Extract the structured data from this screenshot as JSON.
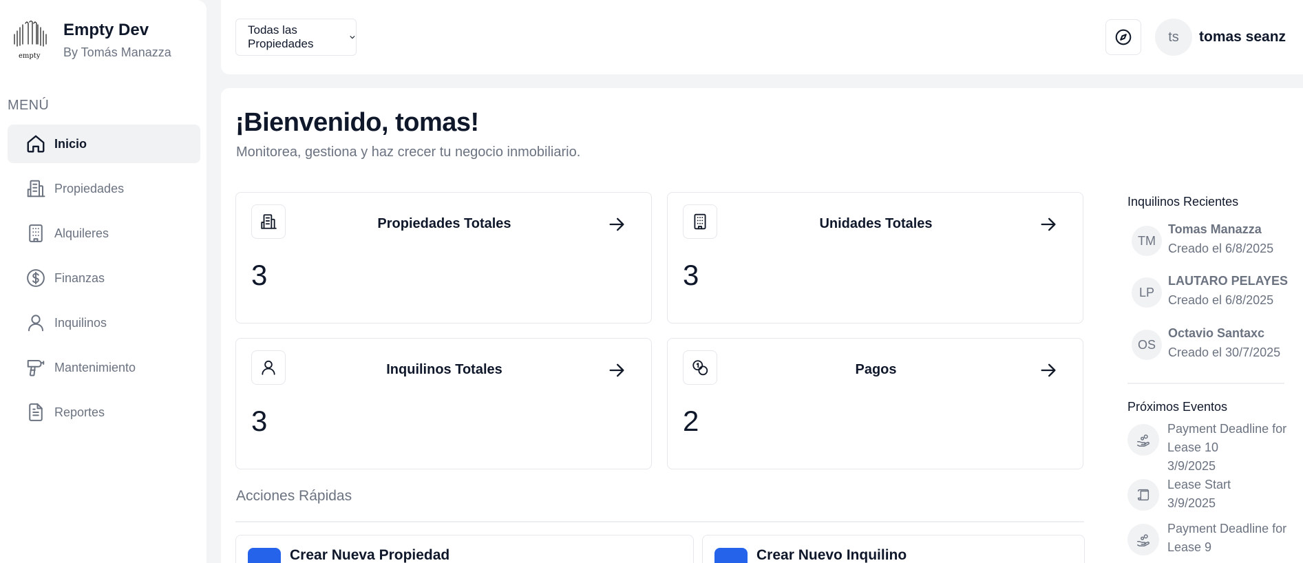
{
  "brand": {
    "logo_word": "empty",
    "name": "Empty Dev",
    "subtitle": "By Tomás Manazza"
  },
  "sidebar": {
    "menu_heading": "MENÚ",
    "items": [
      {
        "label": "Inicio",
        "icon": "home-icon",
        "active": true
      },
      {
        "label": "Propiedades",
        "icon": "building-icon",
        "active": false
      },
      {
        "label": "Alquileres",
        "icon": "office-building-icon",
        "active": false
      },
      {
        "label": "Finanzas",
        "icon": "dollar-circle-icon",
        "active": false
      },
      {
        "label": "Inquilinos",
        "icon": "user-icon",
        "active": false
      },
      {
        "label": "Mantenimiento",
        "icon": "drill-icon",
        "active": false
      },
      {
        "label": "Reportes",
        "icon": "document-icon",
        "active": false
      }
    ]
  },
  "topbar": {
    "property_selector": "Todas las Propiedades",
    "compass_icon": "compass-icon",
    "user_initials": "ts",
    "user_name": "tomas seanz"
  },
  "main": {
    "welcome": "¡Bienvenido, tomas!",
    "subtitle": "Monitorea, gestiona y haz crecer tu negocio inmobiliario.",
    "cards": [
      {
        "title": "Propiedades Totales",
        "value": "3",
        "icon": "building-icon"
      },
      {
        "title": "Unidades Totales",
        "value": "3",
        "icon": "office-building-icon"
      },
      {
        "title": "Inquilinos Totales",
        "value": "3",
        "icon": "user-icon"
      },
      {
        "title": "Pagos",
        "value": "2",
        "icon": "coins-icon"
      }
    ],
    "quick_actions_heading": "Acciones Rápidas",
    "quick_actions": [
      {
        "label": "Crear Nueva Propiedad"
      },
      {
        "label": "Crear Nuevo Inquilino"
      }
    ]
  },
  "right": {
    "tenants_heading": "Inquilinos Recientes",
    "tenants": [
      {
        "initials": "TM",
        "name": "Tomas Manazza",
        "date": "Creado el 6/8/2025"
      },
      {
        "initials": "LP",
        "name": "LAUTARO PELAYES",
        "date": "Creado el 6/8/2025"
      },
      {
        "initials": "OS",
        "name": "Octavio Santaxc",
        "date": "Creado el 30/7/2025"
      }
    ],
    "events_heading": "Próximos Eventos",
    "events": [
      {
        "title": "Payment Deadline for Lease 10",
        "date": "3/9/2025",
        "icon": "hand-coins-icon"
      },
      {
        "title": "Lease Start",
        "date": "3/9/2025",
        "icon": "scroll-icon"
      },
      {
        "title": "Payment Deadline for Lease 9",
        "date": "",
        "icon": "hand-coins-icon"
      }
    ]
  },
  "colors": {
    "accent": "#2563eb",
    "background": "#f3f4f6",
    "text_primary": "#0f172a",
    "text_muted": "#6b7280",
    "border": "#e5e7eb"
  }
}
